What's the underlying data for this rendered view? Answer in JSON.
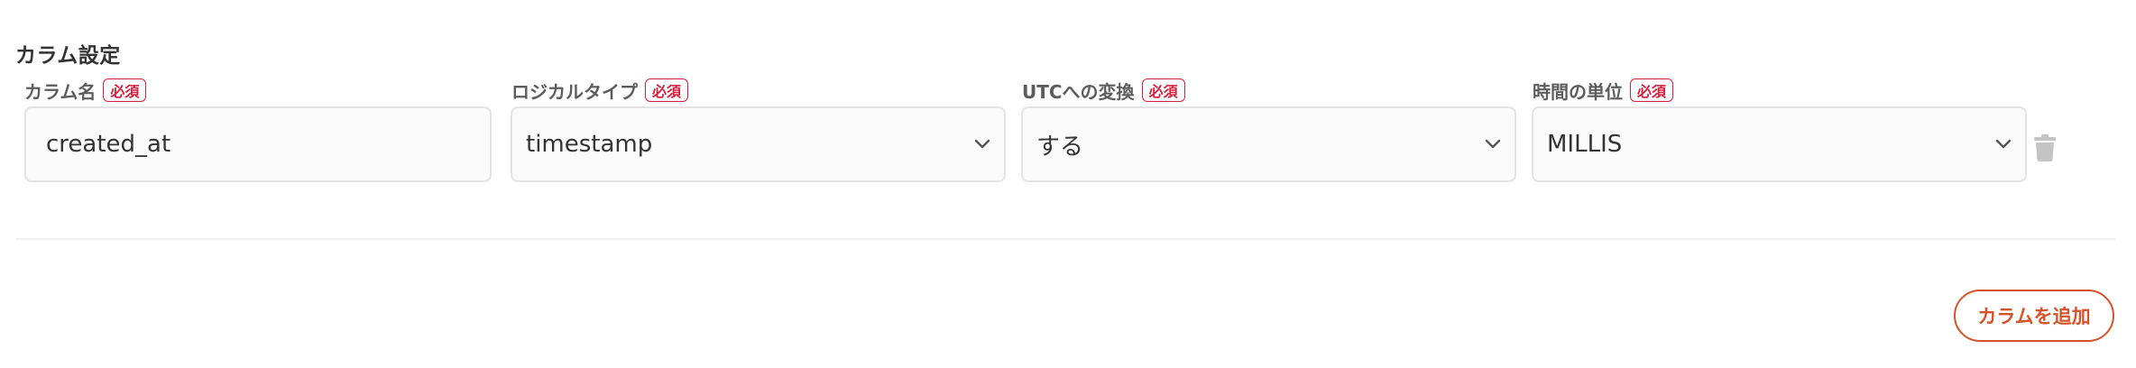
{
  "section": {
    "title": "カラム設定"
  },
  "required_badge": "必須",
  "fields": {
    "column_name": {
      "label": "カラム名",
      "value": "created_at"
    },
    "logical_type": {
      "label": "ロジカルタイプ",
      "value": "timestamp"
    },
    "utc_conversion": {
      "label": "UTCへの変換",
      "value": "する"
    },
    "time_unit": {
      "label": "時間の単位",
      "value": "MILLIS"
    }
  },
  "icons": {
    "chevron": "chevron-down-icon",
    "delete": "trash-icon"
  },
  "actions": {
    "add_column_label": "カラムを追加"
  },
  "colors": {
    "accent": "#d5532a",
    "required": "#d4213d",
    "border": "#e3e3e3",
    "field_bg": "#fafafa"
  }
}
